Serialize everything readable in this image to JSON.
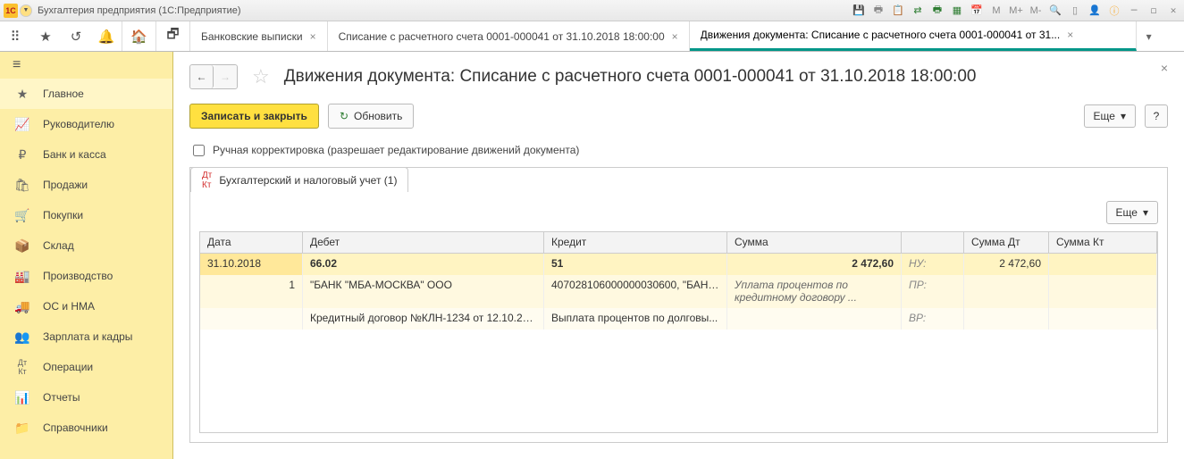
{
  "titlebar": {
    "logo": "1C",
    "app_title": "Бухгалтерия предприятия  (1С:Предприятие)",
    "icons": {
      "m": "M",
      "mp": "M+",
      "mm": "M-"
    }
  },
  "tabs": {
    "t1": "Банковские выписки",
    "t2": "Списание с расчетного счета 0001-000041 от 31.10.2018 18:00:00",
    "t3": "Движения документа: Списание с расчетного счета 0001-000041 от 31..."
  },
  "sidebar": {
    "i0": "Главное",
    "i1": "Руководителю",
    "i2": "Банк и касса",
    "i3": "Продажи",
    "i4": "Покупки",
    "i5": "Склад",
    "i6": "Производство",
    "i7": "ОС и НМА",
    "i8": "Зарплата и кадры",
    "i9": "Операции",
    "i10": "Отчеты",
    "i11": "Справочники"
  },
  "page": {
    "title": "Движения документа: Списание с расчетного счета 0001-000041 от 31.10.2018 18:00:00",
    "save": "Записать и закрыть",
    "refresh": "Обновить",
    "more": "Еще",
    "help": "?",
    "manual_label": "Ручная корректировка (разрешает редактирование движений документа)",
    "tab_label": "Бухгалтерский и налоговый учет (1)"
  },
  "grid": {
    "h_date": "Дата",
    "h_deb": "Дебет",
    "h_cred": "Кредит",
    "h_sum": "Сумма",
    "h_sumdt": "Сумма Дт",
    "h_sumkt": "Сумма Кт",
    "r0_date": "31.10.2018",
    "r0_deb": "66.02",
    "r0_cred": "51",
    "r0_sum": "2 472,60",
    "r0_lbl": "НУ:",
    "r0_sumdt": "2 472,60",
    "r1_n": "1",
    "r1_deb": "\"БАНК \"МБА-МОСКВА\" ООО",
    "r1_cred": "407028106000000030600, \"БАНК ...",
    "r1_sum": "Уплата процентов по кредитному договору ...",
    "r1_lbl": "ПР:",
    "r2_deb": "Кредитный договор №КЛН-1234 от 12.10.20...",
    "r2_cred": "Выплата процентов по долговы...",
    "r2_lbl": "ВР:"
  }
}
